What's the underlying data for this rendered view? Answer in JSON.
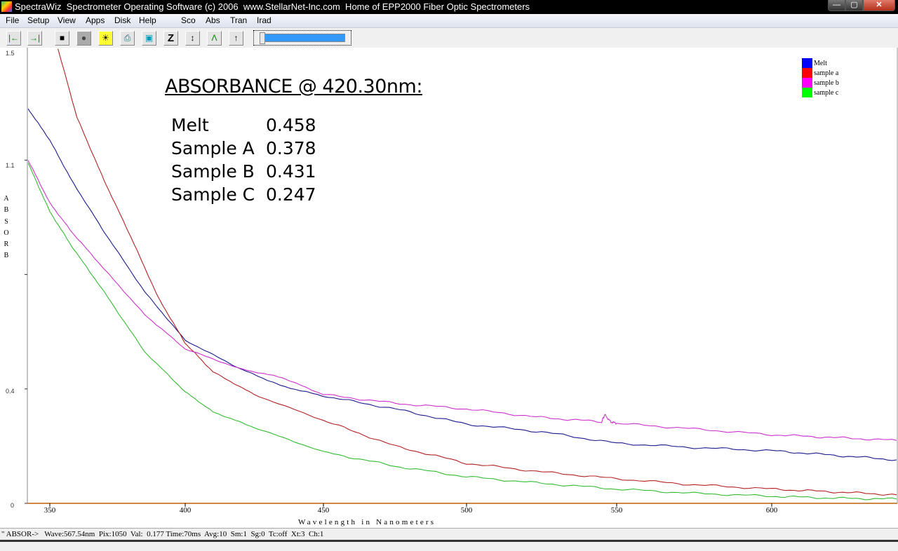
{
  "window": {
    "title": "SpectraWiz  Spectrometer Operating Software (c) 2006  www.StellarNet-Inc.com  Home of EPP2000 Fiber Optic Spectrometers",
    "buttons": {
      "minimize": "—",
      "maximize": "▢",
      "close": "✕"
    }
  },
  "menubar": {
    "items": [
      "File",
      "Setup",
      "View",
      "Apps",
      "Disk",
      "Help",
      "Sco",
      "Abs",
      "Tran",
      "Irad"
    ]
  },
  "toolbar": {
    "buttons": [
      {
        "name": "cursor-left-icon",
        "glyph": "|←"
      },
      {
        "name": "cursor-right-icon",
        "glyph": "→|"
      },
      {
        "name": "store-dark-icon",
        "glyph": "■"
      },
      {
        "name": "lamp-off-icon",
        "glyph": "●"
      },
      {
        "name": "lamp-on-icon",
        "glyph": "☀"
      },
      {
        "name": "print-icon",
        "glyph": "⎙"
      },
      {
        "name": "snapshot-icon",
        "glyph": "▣"
      },
      {
        "name": "zoom-z-icon",
        "glyph": "Z"
      },
      {
        "name": "autoscale-icon",
        "glyph": "↕"
      },
      {
        "name": "peak-icon",
        "glyph": "Λ"
      },
      {
        "name": "scale-up-icon",
        "glyph": "↑"
      }
    ],
    "slider_fraction": 0.03
  },
  "overlay": {
    "title": "ABSORBANCE @ 420.30nm:",
    "rows": [
      {
        "name": "Melt",
        "value": "0.458"
      },
      {
        "name": "Sample A",
        "value": "0.378"
      },
      {
        "name": "Sample B",
        "value": "0.431"
      },
      {
        "name": "Sample C",
        "value": "0.247"
      }
    ]
  },
  "statusbar": {
    "text": "\" ABSOR->   Wave:567.54nm  Pix:1050  Val:  0.177 Time:70ms  Avg:10  Sm:1  Sg:0  Tc:off  Xt:3  Ch:1"
  },
  "chart_data": {
    "type": "line",
    "title": "",
    "xlabel": "Wavelength in Nanometers",
    "ylabel": "ABSORB",
    "ylabel_letters": [
      "A",
      "B",
      "S",
      "O",
      "R",
      "B"
    ],
    "xlim": [
      342,
      640
    ],
    "ylim": [
      0,
      1.6
    ],
    "x_ticks": [
      350,
      400,
      450,
      500,
      550,
      600
    ],
    "y_tick_labels": [
      {
        "value": 0,
        "label": "0"
      },
      {
        "value": 0.4,
        "label": "0.4"
      },
      {
        "value": 1.1,
        "label": "1.1"
      },
      {
        "value": 1.5,
        "label": "1.5"
      }
    ],
    "y_ticks": [
      0,
      0.4,
      0.8,
      1.2
    ],
    "grid": false,
    "legend_position": "top-right",
    "series": [
      {
        "name": "Melt",
        "color": "#0000ff",
        "line_color": "#1a1a8c",
        "x": [
          342,
          350,
          358,
          370,
          385,
          400,
          420,
          435,
          450,
          475,
          500,
          525,
          550,
          575,
          600,
          620,
          640
        ],
        "y": [
          1.38,
          1.27,
          1.13,
          0.95,
          0.74,
          0.57,
          0.47,
          0.41,
          0.375,
          0.33,
          0.277,
          0.25,
          0.21,
          0.195,
          0.184,
          0.168,
          0.152
        ]
      },
      {
        "name": "sample a",
        "color": "#ff0000",
        "line_color": "#b22222",
        "x": [
          353,
          360,
          370,
          380,
          390,
          400,
          410,
          425,
          450,
          475,
          500,
          525,
          550,
          575,
          600,
          620,
          640
        ],
        "y": [
          1.59,
          1.35,
          1.13,
          0.93,
          0.72,
          0.56,
          0.46,
          0.38,
          0.29,
          0.2,
          0.14,
          0.11,
          0.086,
          0.065,
          0.05,
          0.04,
          0.03
        ]
      },
      {
        "name": "sample b",
        "color": "#ff00ff",
        "line_color": "#cc33cc",
        "x": [
          342,
          350,
          358,
          370,
          385,
          400,
          420,
          435,
          450,
          475,
          500,
          525,
          545,
          546,
          548,
          550,
          575,
          600,
          620,
          640
        ],
        "y": [
          1.2,
          1.05,
          0.95,
          0.82,
          0.66,
          0.54,
          0.47,
          0.44,
          0.38,
          0.35,
          0.33,
          0.3,
          0.285,
          0.31,
          0.285,
          0.28,
          0.26,
          0.24,
          0.23,
          0.22
        ]
      },
      {
        "name": "sample c",
        "color": "#00ff00",
        "line_color": "#33bb33",
        "x": [
          342,
          350,
          358,
          370,
          385,
          400,
          410,
          425,
          450,
          475,
          500,
          525,
          550,
          575,
          600,
          620,
          640
        ],
        "y": [
          1.19,
          1.02,
          0.9,
          0.74,
          0.53,
          0.39,
          0.32,
          0.265,
          0.18,
          0.13,
          0.093,
          0.07,
          0.05,
          0.035,
          0.025,
          0.018,
          0.015
        ]
      }
    ]
  }
}
